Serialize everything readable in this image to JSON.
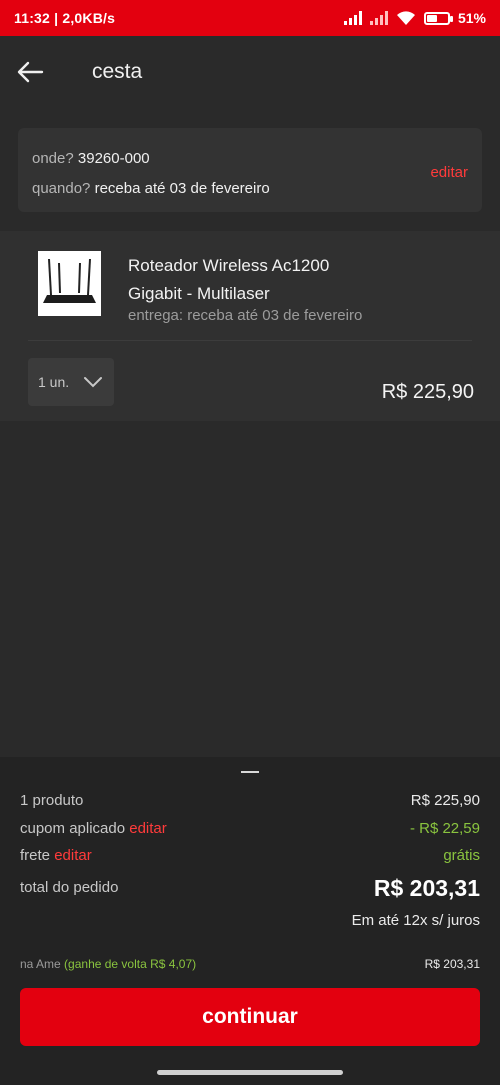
{
  "status_bar": {
    "time": "11:32",
    "network_speed": "2,0KB/s",
    "battery_percent": "51",
    "battery_level": 0.51,
    "icons": [
      "signal-icon",
      "signal-icon",
      "wifi-icon",
      "battery-icon"
    ]
  },
  "header": {
    "title": "cesta"
  },
  "delivery": {
    "where_label": "onde?",
    "where_value": "39260-000",
    "when_label": "quando?",
    "when_value": "receba até 03 de fevereiro",
    "edit_label": "editar"
  },
  "product": {
    "name_line1": "Roteador Wireless Ac1200",
    "name_line2": "Gigabit - Multilaser",
    "delivery": "entrega: receba até 03 de fevereiro",
    "quantity": "1 un.",
    "price": "R$ 225,90"
  },
  "summary": {
    "products_label": "1 produto",
    "products_value": "R$ 225,90",
    "coupon_label": "cupom aplicado",
    "coupon_edit": "editar",
    "coupon_value": "- R$ 22,59",
    "shipping_label": "frete",
    "shipping_edit": "editar",
    "shipping_value": "grátis",
    "total_label": "total do pedido",
    "total_value": "R$ 203,31",
    "installments": "Em até 12x s/ juros",
    "ame_label": "na Ame",
    "ame_cashback": "(ganhe de volta R$ 4,07)",
    "ame_value": "R$ 203,31",
    "continue_label": "continuar"
  },
  "colors": {
    "brand_red": "#e3000f",
    "link_red": "#ff3b3b",
    "success_green": "#8ac43f",
    "background": "#2a2a2a"
  }
}
